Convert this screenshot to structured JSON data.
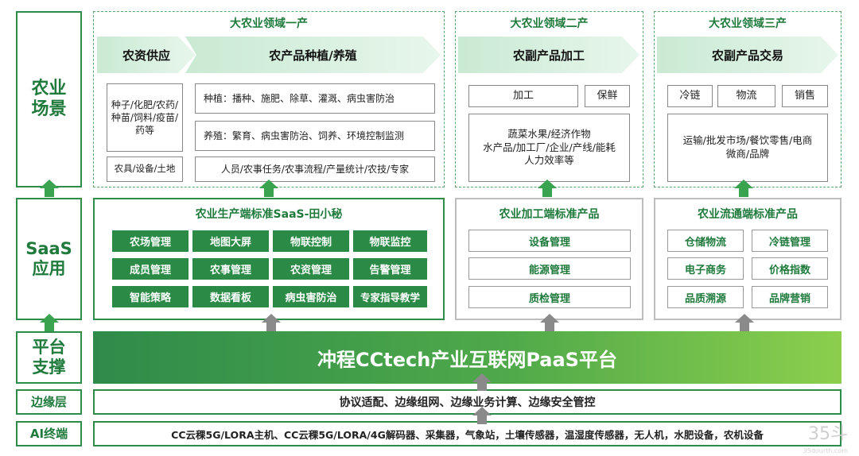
{
  "layers": {
    "scene": "农业场景",
    "saas": "SaaS应用",
    "platform": "平台支撑",
    "edge": "边缘层",
    "terminal": "AI终端"
  },
  "domains": {
    "primary": {
      "title": "大农业领域一产",
      "stages": [
        "农资供应",
        "农产品种植/养殖"
      ],
      "supply_items": [
        "种子/化肥/农药/种苗/饲料/疫苗/药等",
        "农具/设备/土地"
      ],
      "planting": "种植：播种、施肥、除草、灌溉、病虫害防治",
      "breeding": "养殖：繁育、病虫害防治、饲养、环境控制监测",
      "people": "人员/农事任务/农事流程/产量统计/农技/专家"
    },
    "secondary": {
      "title": "大农业领域二产",
      "stage": "农副产品加工",
      "tags": [
        "加工",
        "保鲜"
      ],
      "details": [
        "蔬菜水果/经济作物",
        "水产品/加工厂/企业/产线/能耗",
        "人力效率等"
      ]
    },
    "tertiary": {
      "title": "大农业领域三产",
      "stage": "农副产品交易",
      "tags": [
        "冷链",
        "物流",
        "销售"
      ],
      "details": [
        "运输/批发市场/餐饮零售/电商",
        "微商/品牌"
      ]
    }
  },
  "saas": {
    "production": {
      "title": "农业生产端标准SaaS-田小秘",
      "modules": [
        "农场管理",
        "地图大屏",
        "物联控制",
        "物联监控",
        "成员管理",
        "农事管理",
        "农资管理",
        "告警管理",
        "智能策略",
        "数据看板",
        "病虫害防治",
        "专家指导教学"
      ]
    },
    "processing": {
      "title": "农业加工端标准产品",
      "modules": [
        "设备管理",
        "能源管理",
        "质检管理"
      ]
    },
    "circulation": {
      "title": "农业流通端标准产品",
      "modules": [
        "仓储物流",
        "冷链管理",
        "电子商务",
        "价格指数",
        "品质溯源",
        "品牌营销"
      ]
    }
  },
  "platform": "冲程CCtech产业互联网PaaS平台",
  "edge": "协议适配、边缘组网、边缘业务计算、边缘安全管控",
  "terminal": "CC云稞5G/LORA主机、CC云稞5G/LORA/4G解码器、采集器，气象站，土壤传感器，温湿度传感器，无人机，水肥设备，农机设备",
  "watermark": {
    "mark": "35斗",
    "sub": "35dourth.com"
  },
  "colors": {
    "primary_green": "#2b8a45",
    "accent_green": "#8ccf4d",
    "arrow_gray": "#8a8a8a"
  }
}
